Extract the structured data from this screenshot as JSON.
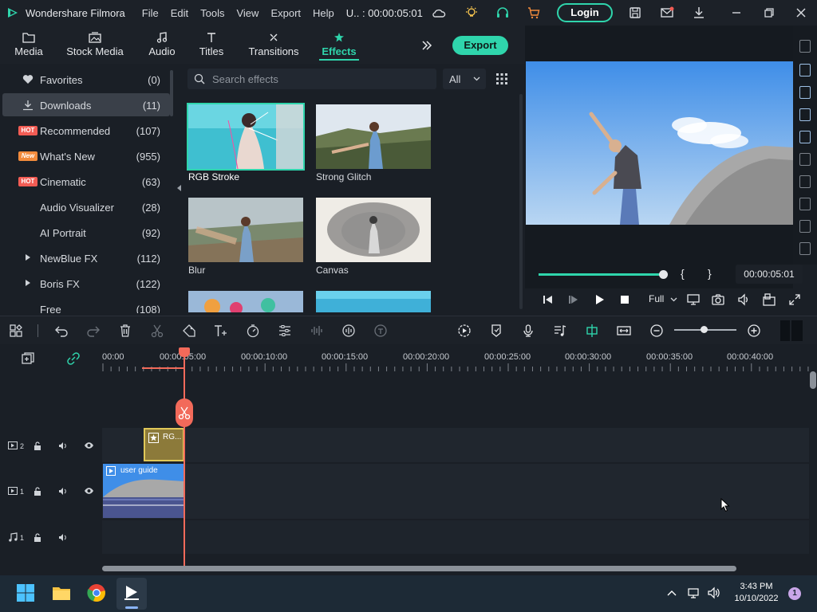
{
  "titlebar": {
    "app_name": "Wondershare Filmora",
    "menu": [
      "File",
      "Edit",
      "Tools",
      "View",
      "Export",
      "Help"
    ],
    "project": "U.. : 00:00:05:01",
    "login_label": "Login"
  },
  "nav": {
    "tabs": [
      {
        "label": "Media",
        "icon": "folder-icon"
      },
      {
        "label": "Stock Media",
        "icon": "stock-media-icon"
      },
      {
        "label": "Audio",
        "icon": "music-note-icon"
      },
      {
        "label": "Titles",
        "icon": "text-icon"
      },
      {
        "label": "Transitions",
        "icon": "transition-icon"
      },
      {
        "label": "Effects",
        "icon": "effects-icon",
        "active": true
      }
    ],
    "export_label": "Export"
  },
  "sidebar": {
    "items": [
      {
        "label": "Favorites",
        "count": "(0)",
        "icon": "heart-icon"
      },
      {
        "label": "Downloads",
        "count": "(11)",
        "icon": "download-icon",
        "selected": true
      },
      {
        "label": "Recommended",
        "count": "(107)",
        "badge": "HOT"
      },
      {
        "label": "What's New",
        "count": "(955)",
        "badge": "New"
      },
      {
        "label": "Cinematic",
        "count": "(63)",
        "badge": "HOT"
      },
      {
        "label": "Audio Visualizer",
        "count": "(28)"
      },
      {
        "label": "AI Portrait",
        "count": "(92)"
      },
      {
        "label": "NewBlue FX",
        "count": "(112)",
        "expandable": true
      },
      {
        "label": "Boris FX",
        "count": "(122)",
        "expandable": true
      },
      {
        "label": "Free",
        "count": "(108)"
      }
    ]
  },
  "effects": {
    "search_placeholder": "Search effects",
    "filter_value": "All",
    "items": [
      {
        "label": "RGB Stroke",
        "selected": true
      },
      {
        "label": "Strong Glitch"
      },
      {
        "label": "Blur"
      },
      {
        "label": "Canvas"
      }
    ]
  },
  "preview": {
    "timecode": "00:00:05:01",
    "quality": "Full",
    "progress": 1.0,
    "bracket_in": "{",
    "bracket_out": "}"
  },
  "timeline": {
    "ruler": [
      "00:00",
      "00:00:05:00",
      "00:00:10:00",
      "00:00:15:00",
      "00:00:20:00",
      "00:00:25:00",
      "00:00:30:00",
      "00:00:35:00",
      "00:00:40:00"
    ],
    "tracks": [
      {
        "type": "video",
        "number": "2"
      },
      {
        "type": "video",
        "number": "1"
      },
      {
        "type": "audio",
        "number": "1"
      }
    ],
    "clips": {
      "effect_clip": "RG...",
      "video_clip": "user guide"
    }
  },
  "taskbar": {
    "time": "3:43 PM",
    "date": "10/10/2022",
    "notifications": "1"
  },
  "colors": {
    "accent": "#2fd5ac",
    "playhead": "#f26a5a",
    "background": "#1a1f26"
  }
}
